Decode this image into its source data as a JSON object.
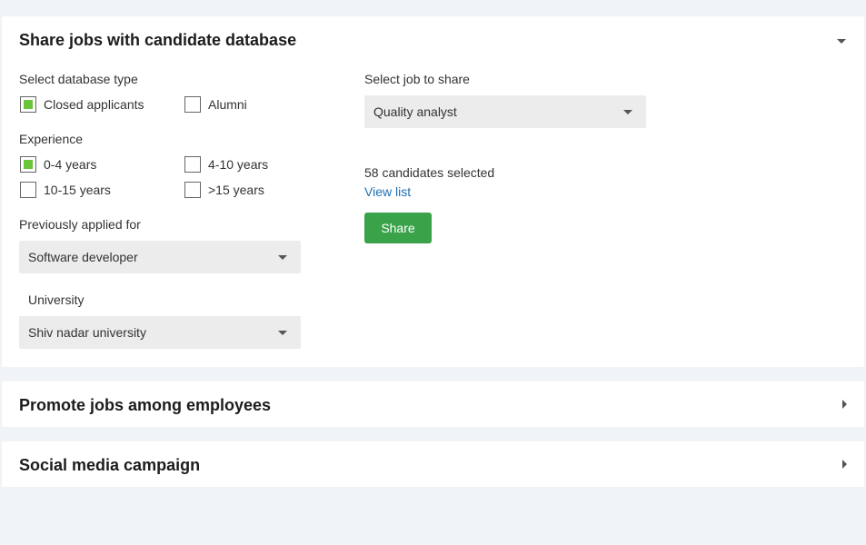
{
  "share_section": {
    "title": "Share jobs with candidate database",
    "database_type_label": "Select database type",
    "database_types": [
      {
        "label": "Closed applicants",
        "checked": true
      },
      {
        "label": "Alumni",
        "checked": false
      }
    ],
    "experience_label": "Experience",
    "experience_options": [
      {
        "label": "0-4 years",
        "checked": true
      },
      {
        "label": "4-10 years",
        "checked": false
      },
      {
        "label": "10-15 years",
        "checked": false
      },
      {
        "label": ">15 years",
        "checked": false
      }
    ],
    "previously_applied_label": "Previously applied for",
    "previously_applied_value": "Software developer",
    "university_label": "University",
    "university_value": "Shiv nadar university",
    "job_label": "Select job to share",
    "job_value": "Quality analyst",
    "candidates_selected": "58 candidates selected",
    "view_list_label": "View list",
    "share_button_label": "Share"
  },
  "promote_section": {
    "title": "Promote jobs among employees"
  },
  "social_section": {
    "title": "Social media campaign"
  },
  "colors": {
    "checkbox_fill": "#6ac53a",
    "share_button": "#3aa34a",
    "link": "#1f6fb5"
  }
}
